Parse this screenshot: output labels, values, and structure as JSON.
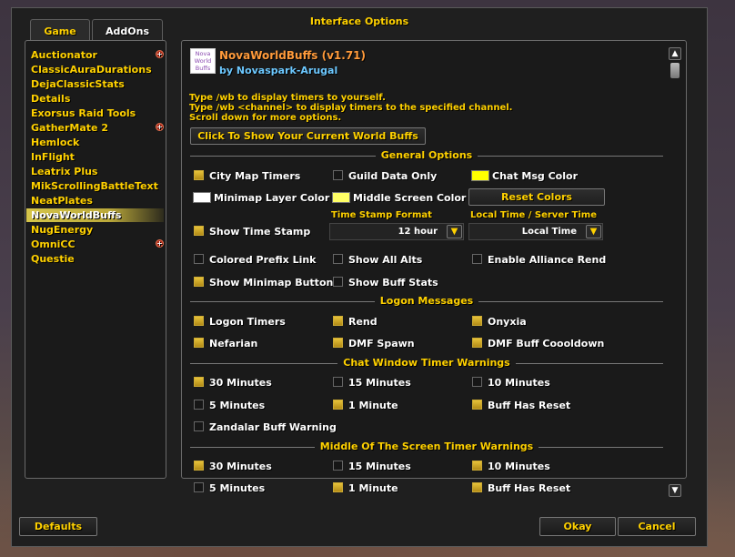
{
  "window": {
    "title": "Interface Options"
  },
  "tabs": [
    {
      "label": "Game"
    },
    {
      "label": "AddOns"
    }
  ],
  "addons": [
    {
      "label": "Auctionator",
      "expand": true
    },
    {
      "label": "ClassicAuraDurations",
      "expand": false
    },
    {
      "label": "DejaClassicStats",
      "expand": false
    },
    {
      "label": "Details",
      "expand": false
    },
    {
      "label": "Exorsus Raid Tools",
      "expand": false
    },
    {
      "label": "GatherMate 2",
      "expand": true
    },
    {
      "label": "Hemlock",
      "expand": false
    },
    {
      "label": "InFlight",
      "expand": false
    },
    {
      "label": "Leatrix Plus",
      "expand": false
    },
    {
      "label": "MikScrollingBattleText",
      "expand": false
    },
    {
      "label": "NeatPlates",
      "expand": false
    },
    {
      "label": "NovaWorldBuffs",
      "expand": false,
      "selected": true
    },
    {
      "label": "NugEnergy",
      "expand": false
    },
    {
      "label": "OmniCC",
      "expand": true
    },
    {
      "label": "Questie",
      "expand": false
    }
  ],
  "addon_header": {
    "logo_lines": [
      "Nova",
      "World",
      "Buffs"
    ],
    "title": "NovaWorldBuffs (v1.71)",
    "author": "by Novaspark-Arugal",
    "help_lines": [
      "Type /wb to display timers to yourself.",
      "Type /wb <channel> to display timers to the specified channel.",
      "Scroll down for more options."
    ],
    "show_buffs_button": "Click To Show Your Current World Buffs"
  },
  "sections": {
    "general": "General Options",
    "logon": "Logon Messages",
    "chat_window": "Chat Window Timer Warnings",
    "middle_screen": "Middle Of The Screen Timer Warnings"
  },
  "general": {
    "city_map_timers": {
      "label": "City Map Timers",
      "checked": true
    },
    "guild_data_only": {
      "label": "Guild Data Only",
      "checked": false
    },
    "chat_msg_color": {
      "label": "Chat Msg Color",
      "color": "#ffff00"
    },
    "minimap_layer_color": {
      "label": "Minimap Layer Color",
      "color": "#ffffff"
    },
    "middle_screen_color": {
      "label": "Middle Screen Color",
      "color": "#ffff66"
    },
    "reset_colors": "Reset Colors",
    "show_time_stamp": {
      "label": "Show Time Stamp",
      "checked": true
    },
    "time_stamp_format": {
      "label": "Time Stamp Format",
      "value": "12 hour"
    },
    "local_server_time": {
      "label": "Local Time / Server Time",
      "value": "Local Time"
    },
    "colored_prefix_link": {
      "label": "Colored Prefix Link",
      "checked": false
    },
    "show_all_alts": {
      "label": "Show All Alts",
      "checked": false
    },
    "enable_alliance_rend": {
      "label": "Enable Alliance Rend",
      "checked": false
    },
    "show_minimap_button": {
      "label": "Show Minimap Button",
      "checked": true
    },
    "show_buff_stats": {
      "label": "Show Buff Stats",
      "checked": false
    }
  },
  "logon": {
    "logon_timers": {
      "label": "Logon Timers",
      "checked": true
    },
    "rend": {
      "label": "Rend",
      "checked": true
    },
    "onyxia": {
      "label": "Onyxia",
      "checked": true
    },
    "nefarian": {
      "label": "Nefarian",
      "checked": true
    },
    "dmf_spawn": {
      "label": "DMF Spawn",
      "checked": true
    },
    "dmf_buff_cooldown": {
      "label": "DMF Buff Coooldown",
      "checked": true
    }
  },
  "chat_window": {
    "m30": {
      "label": "30 Minutes",
      "checked": true
    },
    "m15": {
      "label": "15 Minutes",
      "checked": false
    },
    "m10": {
      "label": "10 Minutes",
      "checked": false
    },
    "m5": {
      "label": "5 Minutes",
      "checked": false
    },
    "m1": {
      "label": "1 Minute",
      "checked": true
    },
    "buff_reset": {
      "label": "Buff Has Reset",
      "checked": true
    },
    "zandalar": {
      "label": "Zandalar Buff Warning",
      "checked": false
    }
  },
  "middle_screen": {
    "m30": {
      "label": "30 Minutes",
      "checked": true
    },
    "m15": {
      "label": "15 Minutes",
      "checked": false
    },
    "m10": {
      "label": "10 Minutes",
      "checked": true
    },
    "m5": {
      "label": "5 Minutes",
      "checked": false
    },
    "m1": {
      "label": "1 Minute",
      "checked": true
    },
    "buff_reset": {
      "label": "Buff Has Reset",
      "checked": true
    }
  },
  "footer": {
    "defaults": "Defaults",
    "okay": "Okay",
    "cancel": "Cancel"
  },
  "icons": {
    "scroll_up": "arrow-up-icon",
    "scroll_down": "arrow-down-icon",
    "dropdown": "chevron-down-icon",
    "expand": "plus-icon"
  }
}
